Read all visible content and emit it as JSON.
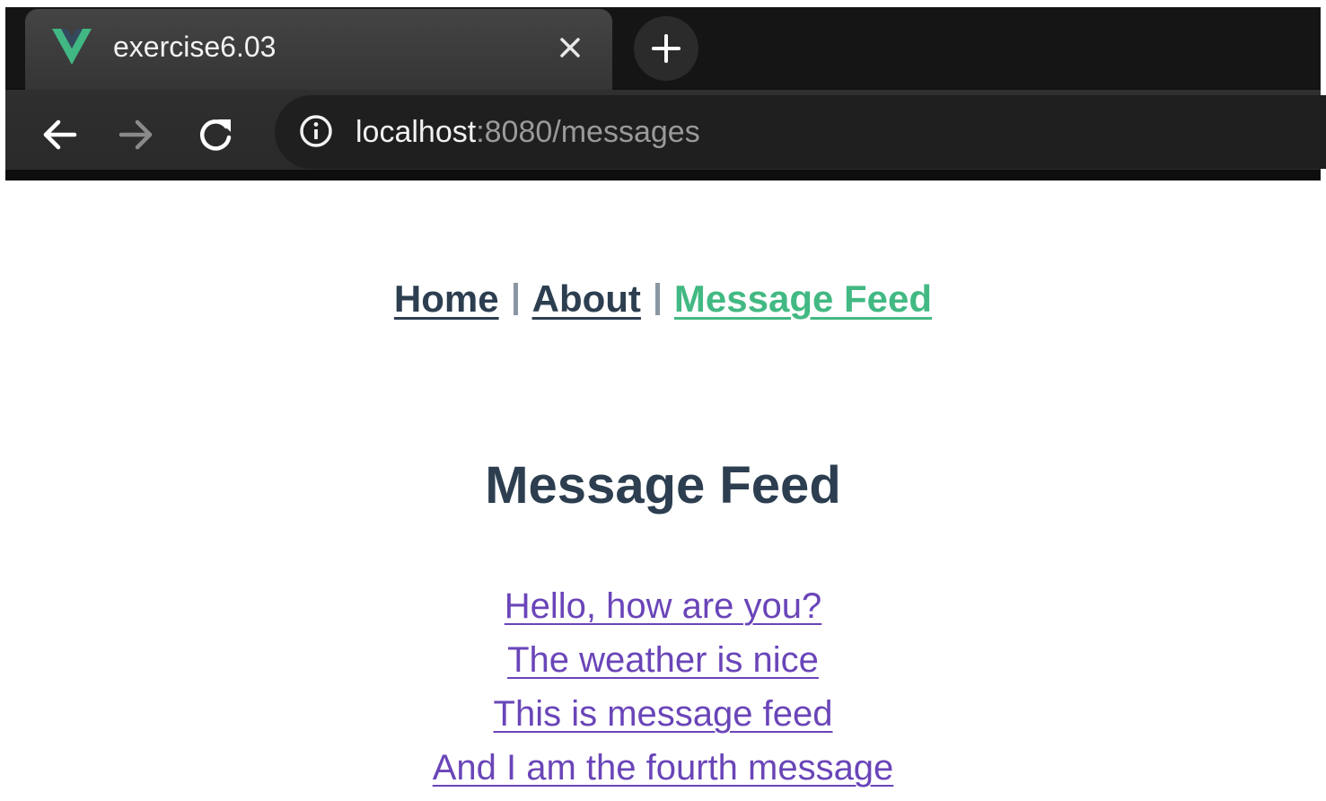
{
  "browser": {
    "tab": {
      "title": "exercise6.03",
      "favicon": "vue-logo-icon"
    },
    "new_tab_label": "+",
    "address": {
      "host": "localhost",
      "path": ":8080/messages"
    }
  },
  "app": {
    "nav": [
      {
        "label": "Home",
        "active": false
      },
      {
        "label": "About",
        "active": false
      },
      {
        "label": "Message Feed",
        "active": true
      }
    ],
    "nav_separator": "|",
    "page_title": "Message Feed",
    "messages": [
      "Hello, how are you?",
      "The weather is nice",
      "This is message feed",
      "And I am the fourth message"
    ]
  },
  "colors": {
    "text_dark": "#2c3e50",
    "active_link": "#42b983",
    "visited_link": "#6a45b8"
  }
}
